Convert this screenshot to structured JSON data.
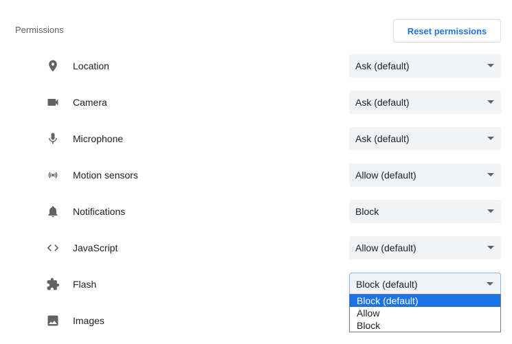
{
  "section": {
    "title": "Permissions",
    "reset_label": "Reset permissions"
  },
  "permissions": [
    {
      "label": "Location",
      "value": "Ask (default)",
      "icon": "location-pin-icon"
    },
    {
      "label": "Camera",
      "value": "Ask (default)",
      "icon": "camera-icon"
    },
    {
      "label": "Microphone",
      "value": "Ask (default)",
      "icon": "microphone-icon"
    },
    {
      "label": "Motion sensors",
      "value": "Allow (default)",
      "icon": "motion-sensors-icon"
    },
    {
      "label": "Notifications",
      "value": "Block",
      "icon": "bell-icon"
    },
    {
      "label": "JavaScript",
      "value": "Allow (default)",
      "icon": "code-icon"
    },
    {
      "label": "Flash",
      "value": "Block (default)",
      "icon": "puzzle-icon"
    },
    {
      "label": "Images",
      "value": "",
      "icon": "image-icon"
    }
  ],
  "flash_dropdown": {
    "options": [
      "Block (default)",
      "Allow",
      "Block"
    ],
    "selected": "Block (default)"
  },
  "colors": {
    "accent": "#1a73e8",
    "select_bg": "#f1f3f4",
    "icon": "#5f6368"
  }
}
